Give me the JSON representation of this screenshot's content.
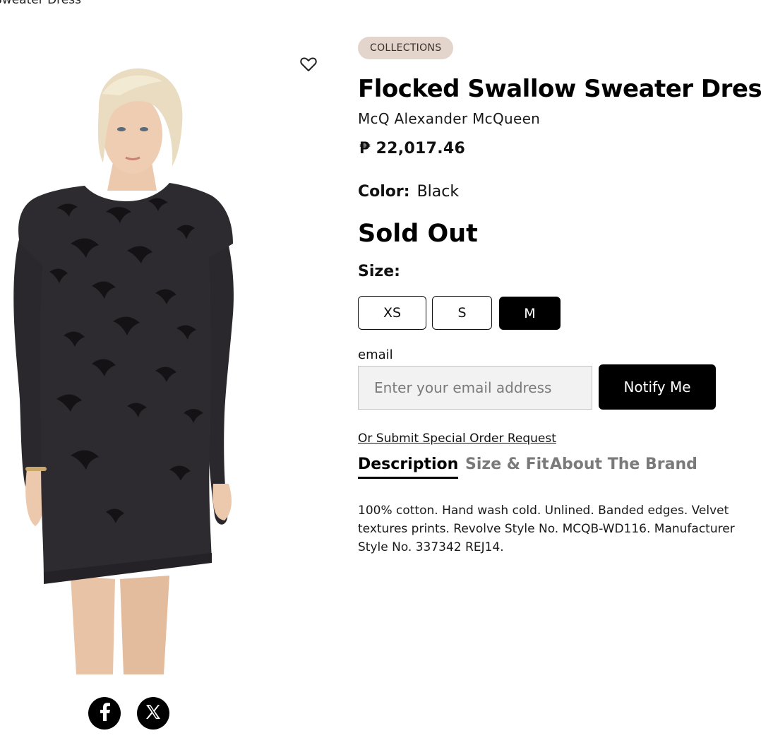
{
  "breadcrumb": {
    "current": "Sweater Dress"
  },
  "product": {
    "collection_label": "COLLECTIONS",
    "title": "Flocked Swallow Sweater Dress",
    "brand": "McQ Alexander McQueen",
    "price": "₱ 22,017.46",
    "color_label": "Color:",
    "color_value": "Black",
    "availability": "Sold Out",
    "size_label": "Size:",
    "sizes": [
      "XS",
      "S",
      "M"
    ],
    "selected_size": "M"
  },
  "notify": {
    "email_label": "email",
    "email_placeholder": "Enter your email address",
    "email_value": "",
    "button_label": "Notify Me"
  },
  "special_order_link": "Or Submit Special Order Request",
  "tabs": [
    {
      "label": "Description",
      "active": true
    },
    {
      "label": "Size & Fit",
      "active": false
    },
    {
      "label": "About The Brand",
      "active": false
    }
  ],
  "description": "100% cotton. Hand wash cold. Unlined. Banded edges. Velvet textures prints. Revolve Style No. MCQB-WD116. Manufacturer Style No. 337342 REJ14.",
  "icons": {
    "favorite": "heart-icon",
    "share": [
      "facebook-icon",
      "x-icon"
    ]
  },
  "colors": {
    "pill_bg": "#e3d5cc",
    "primary": "#000000",
    "input_bg": "#f2f2f2",
    "inactive_tab": "#7a7a7a"
  }
}
